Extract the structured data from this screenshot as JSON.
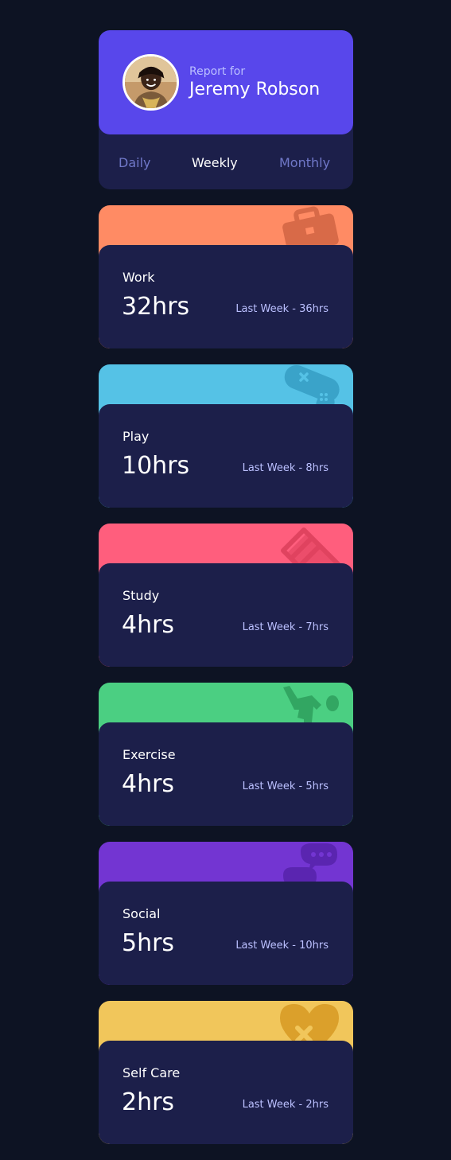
{
  "profile": {
    "report_for": "Report for",
    "name": "Jeremy Robson"
  },
  "tabs": [
    {
      "label": "Daily",
      "active": false
    },
    {
      "label": "Weekly",
      "active": true
    },
    {
      "label": "Monthly",
      "active": false
    }
  ],
  "cards": [
    {
      "title": "Work",
      "hours": "32hrs",
      "previous": "Last Week - 36hrs",
      "color": "#ff8b64",
      "icon": "briefcase-icon"
    },
    {
      "title": "Play",
      "hours": "10hrs",
      "previous": "Last Week - 8hrs",
      "color": "#55c2e6",
      "icon": "gamepad-icon"
    },
    {
      "title": "Study",
      "hours": "4hrs",
      "previous": "Last Week - 7hrs",
      "color": "#ff5e7d",
      "icon": "books-icon"
    },
    {
      "title": "Exercise",
      "hours": "4hrs",
      "previous": "Last Week - 5hrs",
      "color": "#4bcf82",
      "icon": "running-icon"
    },
    {
      "title": "Social",
      "hours": "5hrs",
      "previous": "Last Week - 10hrs",
      "color": "#7335d2",
      "icon": "chat-bubbles-icon"
    },
    {
      "title": "Self Care",
      "hours": "2hrs",
      "previous": "Last Week - 2hrs",
      "color": "#f1c65b",
      "icon": "heart-icon"
    }
  ],
  "colors": {
    "page_bg": "#0d1323",
    "card_bg": "#1c1f4a",
    "profile_bg": "#5847eb",
    "muted_text": "#bbc0ff",
    "inactive_tab": "#7078c9"
  }
}
